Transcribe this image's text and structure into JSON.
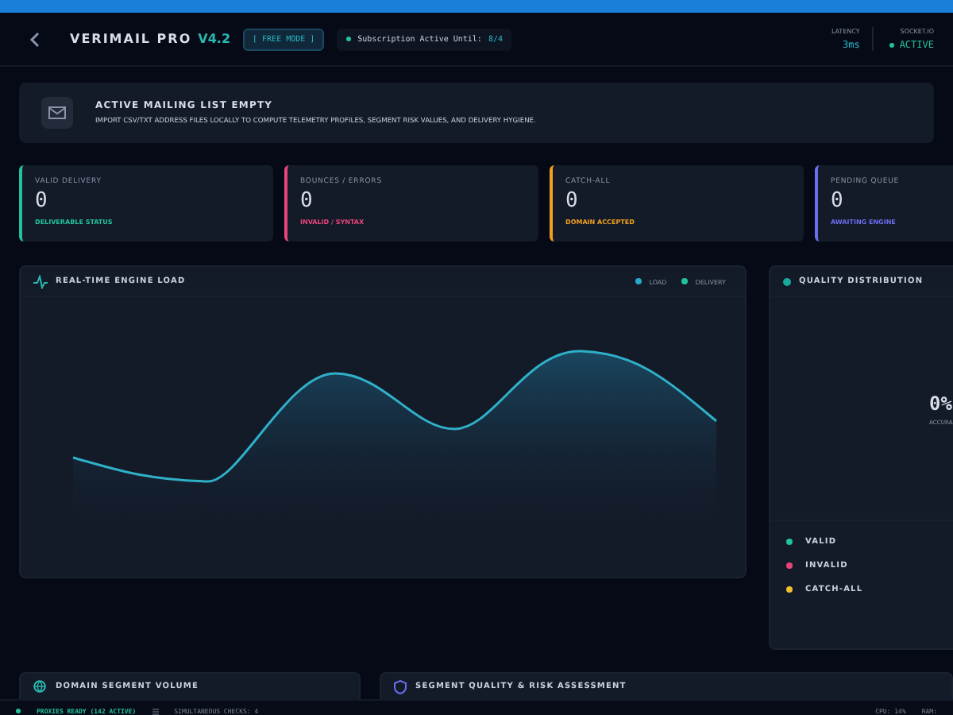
{
  "header": {
    "brand": "VERIMAIL PRO",
    "version": "V4.2",
    "mode_badge": "[ FREE MODE ]",
    "subscription": {
      "label": "Subscription Active Until:",
      "value": "8/4"
    },
    "metrics": [
      {
        "label": "LATENCY",
        "value": "3ms",
        "kind": "text"
      },
      {
        "label": "SOCKET.IO",
        "value": "ACTIVE",
        "kind": "status"
      }
    ]
  },
  "banner": {
    "title": "ACTIVE MAILING LIST EMPTY",
    "text": "IMPORT CSV/TXT ADDRESS FILES LOCALLY TO COMPUTE TELEMETRY PROFILES, SEGMENT RISK VALUES, AND DELIVERY HYGIENE."
  },
  "stats": [
    {
      "label": "VALID DELIVERY",
      "value": "0",
      "caption": "DELIVERABLE STATUS",
      "color": "#22c39a"
    },
    {
      "label": "BOUNCES / ERRORS",
      "value": "0",
      "caption": "INVALID / SYNTAX",
      "color": "#e8457a"
    },
    {
      "label": "CATCH-ALL",
      "value": "0",
      "caption": "DOMAIN ACCEPTED",
      "color": "#f0a020"
    },
    {
      "label": "PENDING QUEUE",
      "value": "0",
      "caption": "AWAITING ENGINE",
      "color": "#6a6ff0"
    }
  ],
  "engine_panel": {
    "title": "REAL-TIME ENGINE LOAD",
    "legend": [
      {
        "label": "LOAD",
        "color": "#2aa8c8"
      },
      {
        "label": "DELIVERY",
        "color": "#22c39a"
      }
    ]
  },
  "quality_panel": {
    "title": "QUALITY DISTRIBUTION",
    "value": "0%",
    "caption": "ACCURA",
    "legend": [
      {
        "label": "VALID",
        "color": "#22c39a"
      },
      {
        "label": "INVALID",
        "color": "#e8457a"
      },
      {
        "label": "CATCH-ALL",
        "color": "#f0c030"
      }
    ]
  },
  "bottom_panels": [
    {
      "title": "DOMAIN SEGMENT VOLUME",
      "kind": "globe"
    },
    {
      "title": "SEGMENT QUALITY & RISK ASSESSMENT",
      "kind": "shield"
    }
  ],
  "status_bar": {
    "ready": "PROXIES READY (142 ACTIVE)",
    "checks": "SIMULTANEOUS CHECKS: 4",
    "cpu": "CPU: 14%",
    "ram": "RAM:"
  }
}
